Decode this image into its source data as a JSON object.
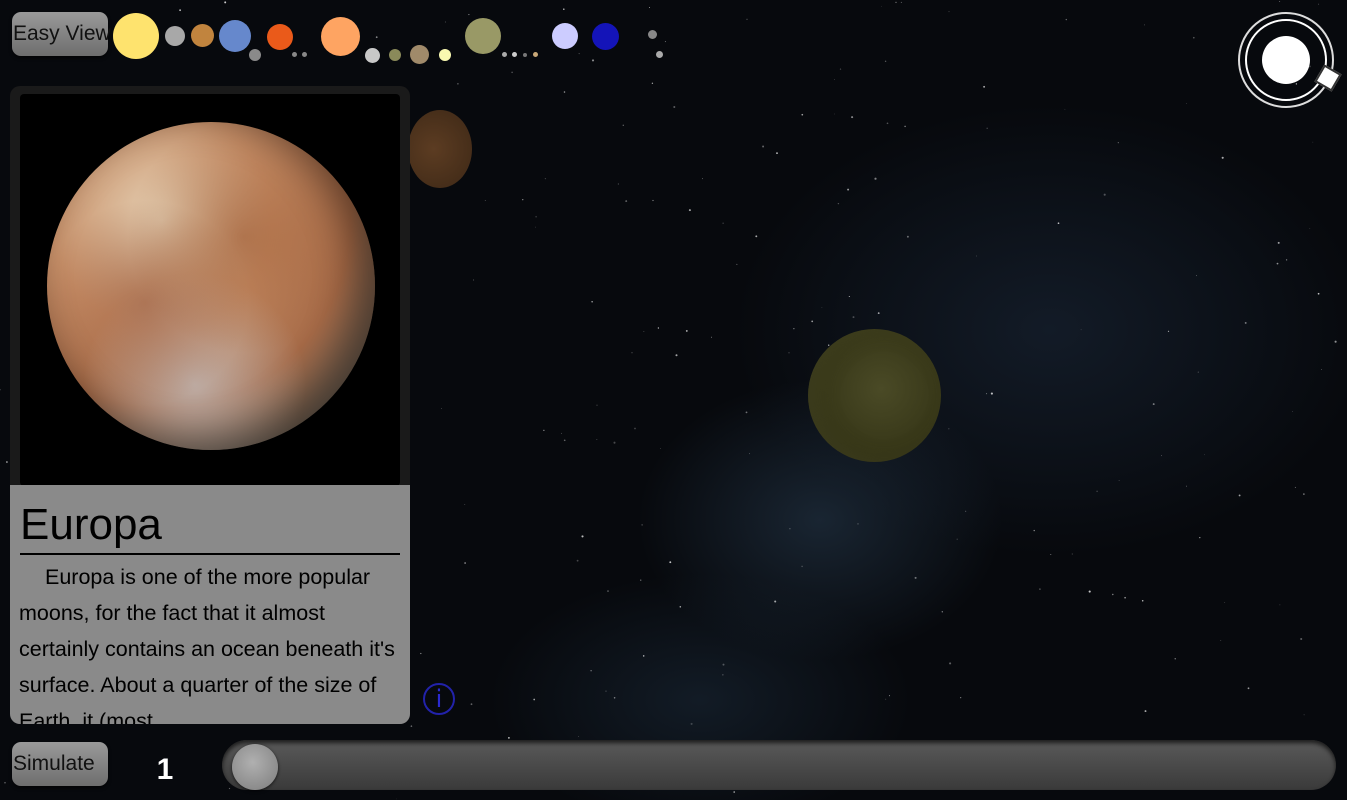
{
  "toolbar": {
    "easy_view_label": "Easy View",
    "bodies": [
      {
        "name": "sun-icon",
        "color": "#fee36e"
      },
      {
        "name": "mercury-icon",
        "color": "#a8a8a8"
      },
      {
        "name": "venus-icon",
        "color": "#c1843e"
      },
      {
        "name": "earth-icon",
        "color": "#6688cc"
      },
      {
        "name": "moon-icon",
        "color": "#8a8a8a"
      },
      {
        "name": "mars-icon",
        "color": "#ea5a1a"
      },
      {
        "name": "phobos-icon",
        "color": "#888888"
      },
      {
        "name": "deimos-icon",
        "color": "#888888"
      },
      {
        "name": "jupiter-icon",
        "color": "#fea462"
      },
      {
        "name": "io-icon",
        "color": "#c8c8c8"
      },
      {
        "name": "europa-icon",
        "color": "#8a8a5a"
      },
      {
        "name": "ganymede-icon",
        "color": "#a08a6a"
      },
      {
        "name": "callisto-icon",
        "color": "#f8f8b0"
      },
      {
        "name": "saturn-icon",
        "color": "#999966"
      },
      {
        "name": "saturn-moon-1-icon",
        "color": "#aaaaaa"
      },
      {
        "name": "saturn-moon-2-icon",
        "color": "#cccccc"
      },
      {
        "name": "saturn-moon-3-icon",
        "color": "#777777"
      },
      {
        "name": "saturn-moon-4-icon",
        "color": "#c8a878"
      },
      {
        "name": "uranus-icon",
        "color": "#ccccff"
      },
      {
        "name": "neptune-icon",
        "color": "#1414b8"
      },
      {
        "name": "pluto-icon",
        "color": "#888888"
      },
      {
        "name": "charon-icon",
        "color": "#aaaaaa"
      }
    ]
  },
  "info_card": {
    "title": "Europa",
    "description": "Europa is one of the more popular moons, for the fact that it almost certainly contains an ocean beneath it's surface. About a quarter of the size of Earth, it (most"
  },
  "info_button": {
    "icon": "info-icon",
    "glyph": "i"
  },
  "simulation": {
    "simulate_label": "Simulate",
    "speed_value": "1",
    "slider_fraction": 0.0
  },
  "view_controls": {
    "orbit_icon": "orbit-view-icon"
  }
}
